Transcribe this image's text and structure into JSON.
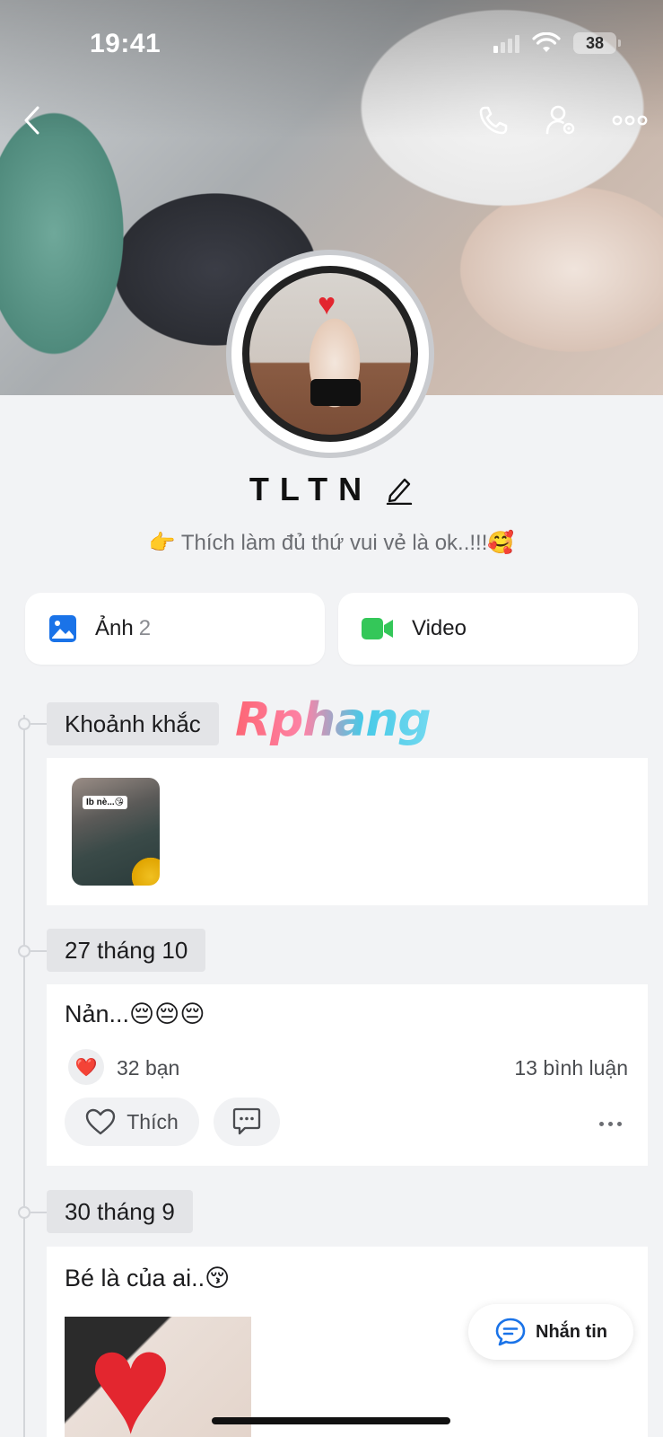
{
  "status_bar": {
    "time": "19:41",
    "battery": "38"
  },
  "profile": {
    "name": "TLTN",
    "bio": "👉 Thích làm đủ thứ vui vẻ là ok..!!!🥰"
  },
  "media": {
    "photos": {
      "label": "Ảnh",
      "count": "2"
    },
    "video": {
      "label": "Video"
    }
  },
  "watermark": "Rphang",
  "timeline": {
    "moments": {
      "tag": "Khoảnh khắc",
      "thumb_caption": "Ib nè...😘"
    },
    "post1": {
      "date": "27 tháng 10",
      "text": "Nản...😔😔😔",
      "reaction": "❤️",
      "likes": "32 bạn",
      "comments": "13 bình luận",
      "like_label": "Thích"
    },
    "post2": {
      "date": "30 tháng 9",
      "text": "Bé là của ai..😚"
    }
  },
  "fab": {
    "label": "Nhắn tin"
  },
  "icons": {
    "back": "chevron-left-icon",
    "call": "phone-icon",
    "profile_settings": "user-gear-icon",
    "more": "more-horizontal-icon",
    "photos": "image-icon",
    "video": "video-camera-icon",
    "like": "heart-outline-icon",
    "comment": "comment-icon",
    "message": "message-bubble-icon",
    "edit": "pencil-icon"
  },
  "colors": {
    "accent": "#1a73e8",
    "video": "#34c759",
    "reaction": "#e0242c"
  }
}
